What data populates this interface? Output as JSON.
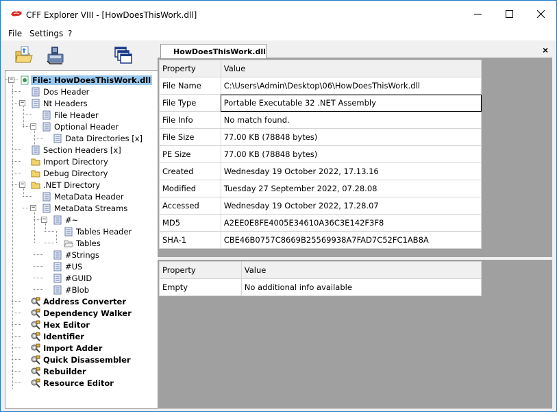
{
  "window": {
    "title": "CFF Explorer VIII - [HowDoesThisWork.dll]",
    "accent": "#1979ca"
  },
  "menu": [
    "File",
    "Settings",
    "?"
  ],
  "toolbar": {
    "icons": [
      "open-folder-icon",
      "save-disk-icon",
      "windows-icon"
    ]
  },
  "tab": {
    "label": "HowDoesThisWork.dll",
    "close": "×"
  },
  "tree": [
    {
      "label": "File: HowDoesThisWork.dll",
      "icon": "file-icon",
      "bold": true,
      "selected": true,
      "expander": "−"
    },
    {
      "label": "Dos Header",
      "icon": "doc-icon"
    },
    {
      "label": "Nt Headers",
      "icon": "doc-icon",
      "expander": "−"
    },
    {
      "label": "File Header",
      "icon": "doc-icon"
    },
    {
      "label": "Optional Header",
      "icon": "doc-icon",
      "expander": "−"
    },
    {
      "label": "Data Directories [x]",
      "icon": "doc-icon"
    },
    {
      "label": "Section Headers [x]",
      "icon": "doc-icon"
    },
    {
      "label": "Import Directory",
      "icon": "folder-icon"
    },
    {
      "label": "Debug Directory",
      "icon": "folder-icon"
    },
    {
      "label": ".NET Directory",
      "icon": "folder-icon",
      "expander": "−"
    },
    {
      "label": "MetaData Header",
      "icon": "doc-icon"
    },
    {
      "label": "MetaData Streams",
      "icon": "doc-icon",
      "expander": "−"
    },
    {
      "label": "#~",
      "icon": "doc-icon",
      "expander": "−"
    },
    {
      "label": "Tables Header",
      "icon": "doc-icon"
    },
    {
      "label": "Tables",
      "icon": "folder-open-icon"
    },
    {
      "label": "#Strings",
      "icon": "doc-icon"
    },
    {
      "label": "#US",
      "icon": "doc-icon"
    },
    {
      "label": "#GUID",
      "icon": "doc-icon"
    },
    {
      "label": "#Blob",
      "icon": "doc-icon"
    },
    {
      "label": "Address Converter",
      "icon": "tool-icon",
      "bold": true
    },
    {
      "label": "Dependency Walker",
      "icon": "tool-icon",
      "bold": true
    },
    {
      "label": "Hex Editor",
      "icon": "tool-icon",
      "bold": true
    },
    {
      "label": "Identifier",
      "icon": "tool-icon",
      "bold": true
    },
    {
      "label": "Import Adder",
      "icon": "tool-icon",
      "bold": true
    },
    {
      "label": "Quick Disassembler",
      "icon": "tool-icon",
      "bold": true
    },
    {
      "label": "Rebuilder",
      "icon": "tool-icon",
      "bold": true
    },
    {
      "label": "Resource Editor",
      "icon": "tool-icon",
      "bold": true
    }
  ],
  "main_grid": {
    "columns": [
      "Property",
      "Value"
    ],
    "rows": [
      [
        "File Name",
        "C:\\Users\\Admin\\Desktop\\06\\HowDoesThisWork.dll"
      ],
      [
        "File Type",
        "Portable Executable 32 .NET Assembly"
      ],
      [
        "File Info",
        "No match found."
      ],
      [
        "File Size",
        "77.00 KB (78848 bytes)"
      ],
      [
        "PE Size",
        "77.00 KB (78848 bytes)"
      ],
      [
        "Created",
        "Wednesday 19 October 2022, 17.13.16"
      ],
      [
        "Modified",
        "Tuesday 27 September 2022, 07.28.08"
      ],
      [
        "Accessed",
        "Wednesday 19 October 2022, 17.28.07"
      ],
      [
        "MD5",
        "A2EE0E8FE4005E34610A36C3E142F3F8"
      ],
      [
        "SHA-1",
        "CBE46B0757C8669B25569938A7FAD7C52FC1AB8A"
      ]
    ]
  },
  "info_grid": {
    "columns": [
      "Property",
      "Value"
    ],
    "rows": [
      [
        "Empty",
        "No additional info available"
      ]
    ]
  }
}
